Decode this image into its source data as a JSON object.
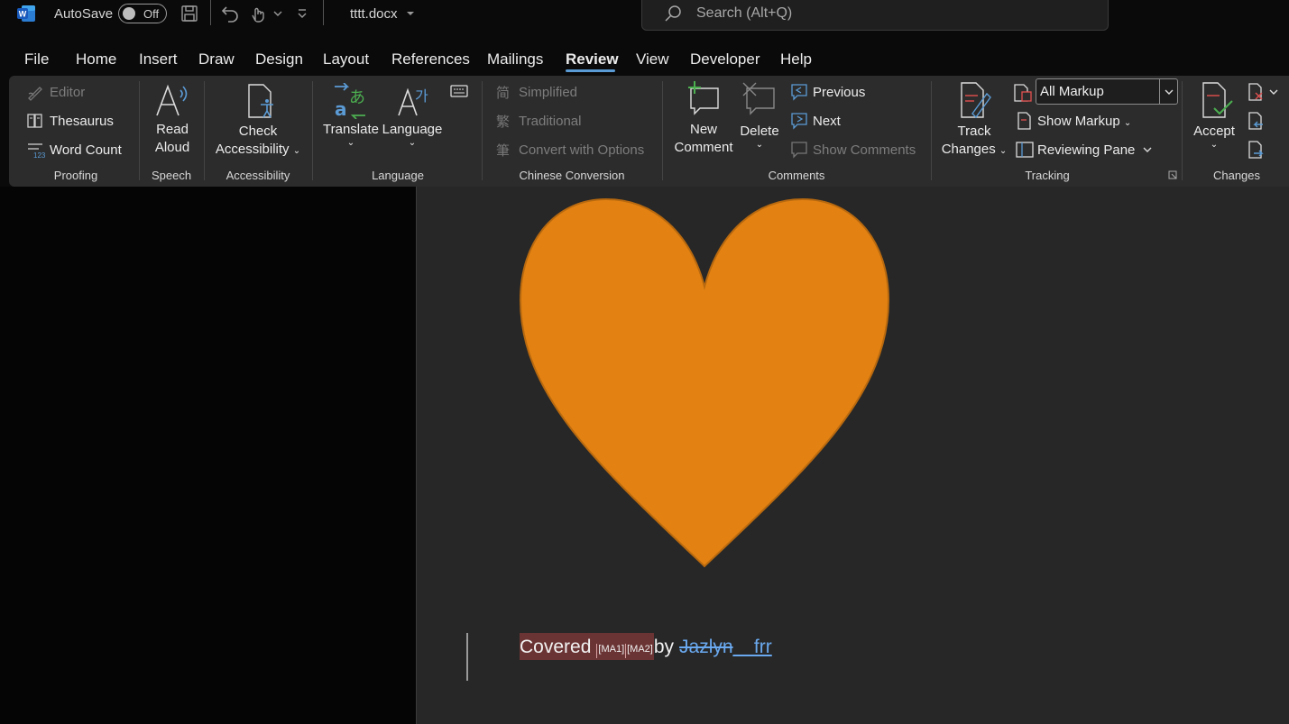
{
  "titlebar": {
    "autosave_label": "AutoSave",
    "autosave_state": "Off",
    "doc_title": "tttt.docx",
    "search_placeholder": "Search (Alt+Q)"
  },
  "tabs": [
    {
      "label": "File"
    },
    {
      "label": "Home"
    },
    {
      "label": "Insert"
    },
    {
      "label": "Draw"
    },
    {
      "label": "Design"
    },
    {
      "label": "Layout"
    },
    {
      "label": "References"
    },
    {
      "label": "Mailings"
    },
    {
      "label": "Review",
      "active": true
    },
    {
      "label": "View"
    },
    {
      "label": "Developer"
    },
    {
      "label": "Help"
    }
  ],
  "ribbon": {
    "proofing": {
      "editor": "Editor",
      "thesaurus": "Thesaurus",
      "word_count": "Word Count",
      "label": "Proofing"
    },
    "speech": {
      "read": "Read",
      "aloud": "Aloud",
      "label": "Speech"
    },
    "accessibility": {
      "check": "Check",
      "accessibility": "Accessibility",
      "label": "Accessibility"
    },
    "language": {
      "translate": "Translate",
      "language": "Language",
      "label": "Language"
    },
    "chinese": {
      "simplified": "Simplified",
      "traditional": "Traditional",
      "convert": "Convert with Options",
      "label": "Chinese Conversion"
    },
    "comments": {
      "new": "New",
      "comment": "Comment",
      "delete": "Delete",
      "previous": "Previous",
      "next": "Next",
      "show": "Show Comments",
      "label": "Comments"
    },
    "tracking": {
      "track": "Track",
      "changes": "Changes",
      "markup_value": "All Markup",
      "show_markup": "Show Markup",
      "reviewing_pane": "Reviewing Pane",
      "label": "Tracking"
    },
    "changes": {
      "accept": "Accept",
      "label": "Changes"
    }
  },
  "document": {
    "word_covered": "Covered",
    "comment_mark_1": "[MA1]",
    "comment_mark_2": "[MA2]",
    "word_by": "by",
    "deleted_text": "Jazlyn",
    "inserted_text": "__frr"
  },
  "colors": {
    "heart_fill": "#E38212",
    "heart_stroke": "#B8690F",
    "accent_blue": "#5B9BD5",
    "revision_blue": "#6AA9EF",
    "comment_highlight": "#6B3434"
  }
}
